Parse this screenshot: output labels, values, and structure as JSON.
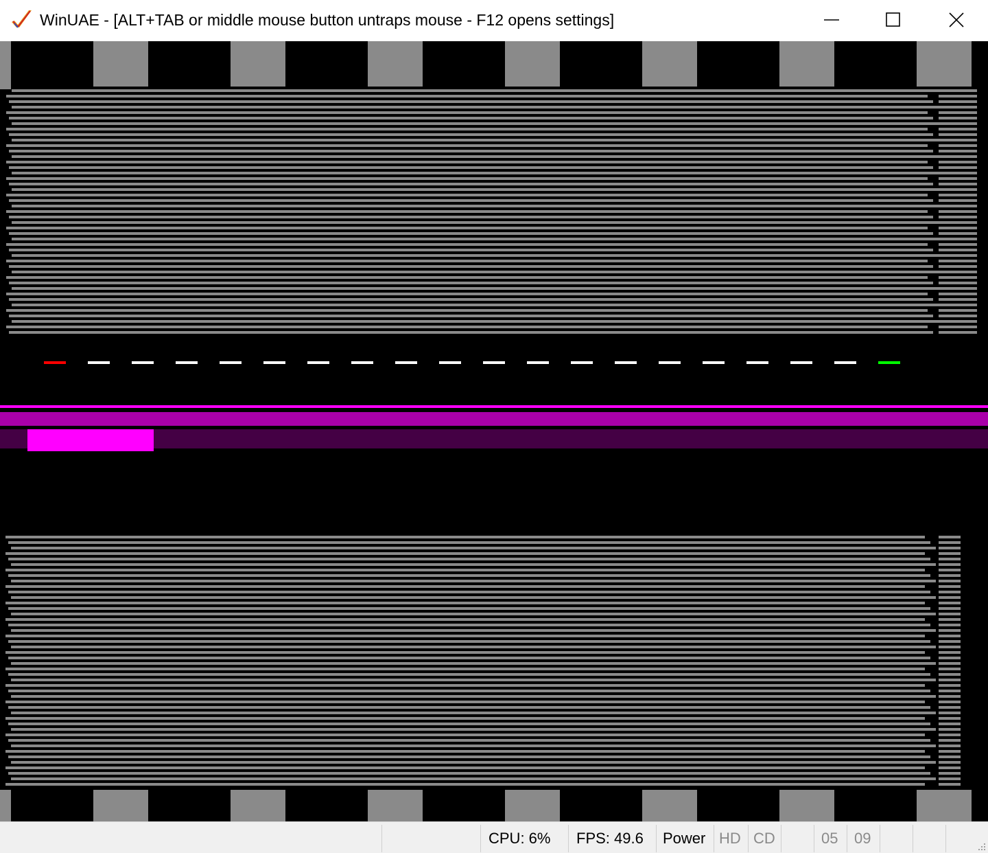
{
  "window": {
    "title": "WinUAE - [ALT+TAB or middle mouse button untraps mouse - F12 opens settings]",
    "app_icon": "winuae-checkmark-icon",
    "controls": {
      "minimize_icon": "minimize-icon",
      "maximize_icon": "maximize-icon",
      "close_icon": "close-icon"
    }
  },
  "display": {
    "background_color": "#000000",
    "stripe_color": "#8a8a8a",
    "copper_colors": [
      "#ff00ff",
      "#aa00aa",
      "#440044"
    ],
    "marker_colors": {
      "left": "#ff0000",
      "middle": "#ffffff",
      "right": "#00ff00"
    }
  },
  "statusbar": {
    "cpu": "CPU: 6%",
    "fps": "FPS: 49.6",
    "power": "Power",
    "hd": "HD",
    "cd": "CD",
    "drive0": "05",
    "drive1": "09",
    "resize_grip_icon": "resize-grip-icon"
  }
}
